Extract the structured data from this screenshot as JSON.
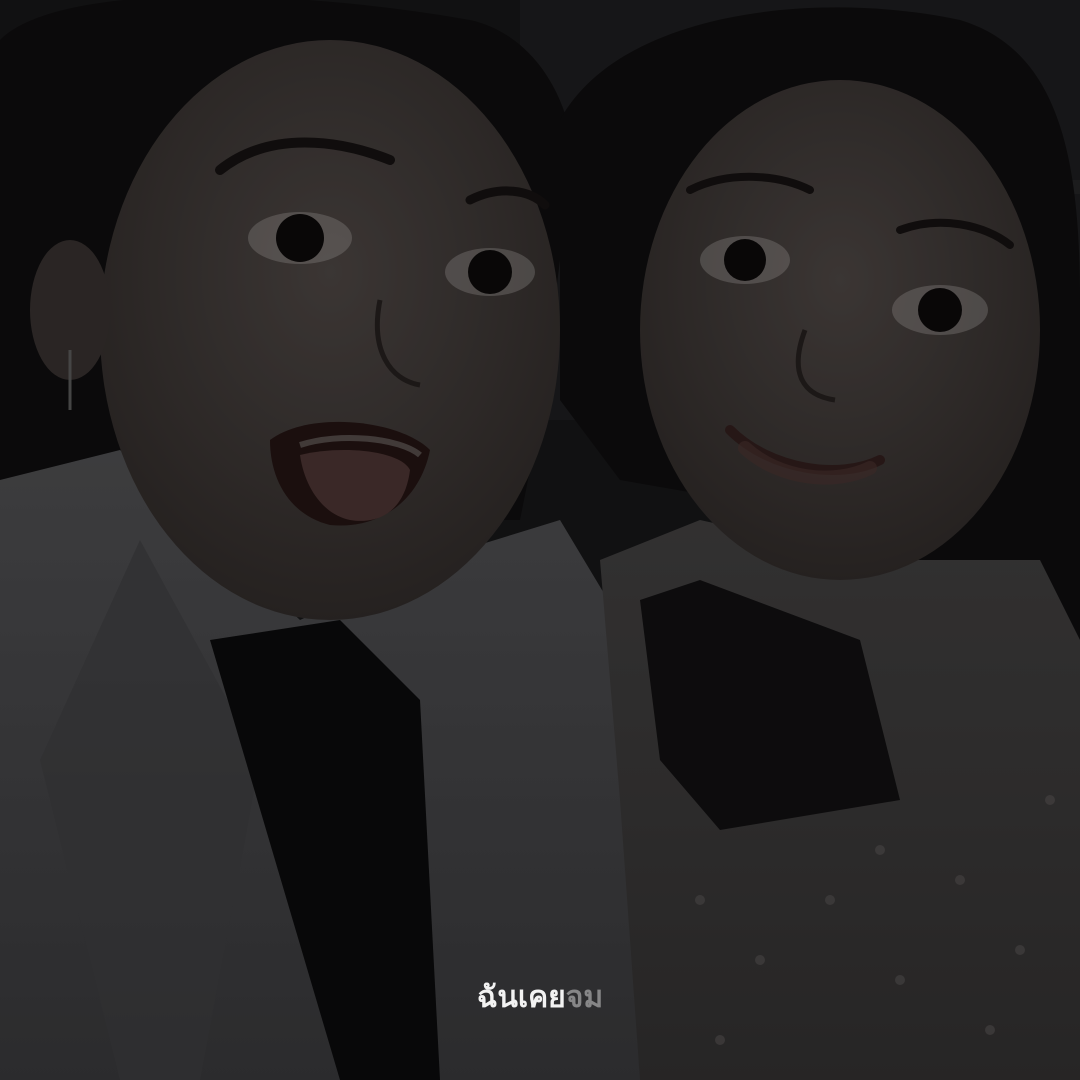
{
  "caption": {
    "shown": "ฉันเคย",
    "fading": "จม"
  }
}
